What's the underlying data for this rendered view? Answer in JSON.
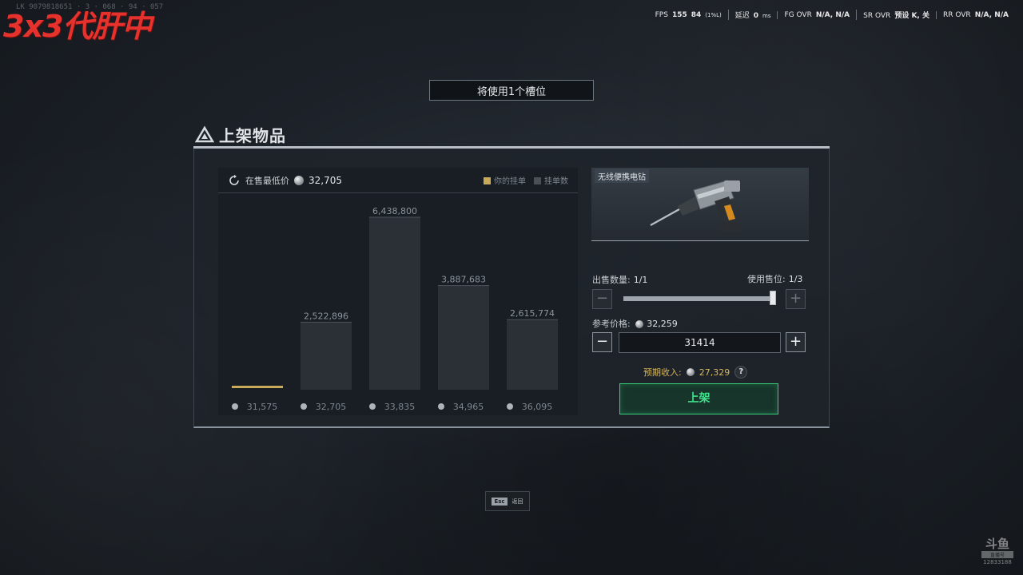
{
  "overlay": {
    "logo": "3x3代肝中",
    "faint_id": "LK 9079818651 · 3 · 068 · 94 · 057",
    "osd": [
      {
        "key": "FPS",
        "value": "155",
        "extra": "84",
        "extra_small": "(1%L)"
      },
      {
        "key": "延迟",
        "value": "0",
        "extra_small": "ms"
      },
      {
        "key": "FG OVR",
        "value": "N/A,  N/A"
      },
      {
        "key": "SR OVR",
        "value": "预设 K,  关"
      },
      {
        "key": "RR OVR",
        "value": "N/A,  N/A"
      }
    ]
  },
  "slot_banner": "将使用1个槽位",
  "title": "上架物品",
  "chart": {
    "lowest_price_label": "在售最低价",
    "lowest_price_value": "32,705",
    "legend": {
      "mine": "你的挂单",
      "count": "挂单数"
    },
    "colors": {
      "mine": "#c9a95a",
      "count": "#4a5056",
      "bar": "#2a3036"
    }
  },
  "chart_data": {
    "type": "bar",
    "title": "",
    "xlabel": "",
    "ylabel": "",
    "categories": [
      "31,575",
      "32,705",
      "33,835",
      "34,965",
      "36,095"
    ],
    "series": [
      {
        "name": "挂单数",
        "values": [
          0,
          2522896,
          6438800,
          3887683,
          2615774
        ]
      }
    ],
    "value_labels": [
      "",
      "2,522,896",
      "6,438,800",
      "3,887,683",
      "2,615,774"
    ],
    "your_listing_category": "31,575",
    "ylim": [
      0,
      6438800
    ],
    "grid": false,
    "legend_position": "top-right"
  },
  "item": {
    "name": "无线便携电钻",
    "quantity_label": "出售数量:",
    "quantity_value": "1/1",
    "slots_label": "使用售位:",
    "slots_value": "1/3",
    "quantity_fraction": 1.0,
    "ref_price_label": "参考价格:",
    "ref_price_value": "32,259",
    "price_input": "31414",
    "income_label": "预期收入:",
    "income_value": "27,329",
    "help": "?",
    "list_button": "上架",
    "minus": "−",
    "plus": "+"
  },
  "footer": {
    "esc_key": "Esc",
    "esc_label": "返回"
  },
  "watermark": {
    "brand": "斗鱼",
    "sub": "直播号",
    "room": "12833188"
  }
}
